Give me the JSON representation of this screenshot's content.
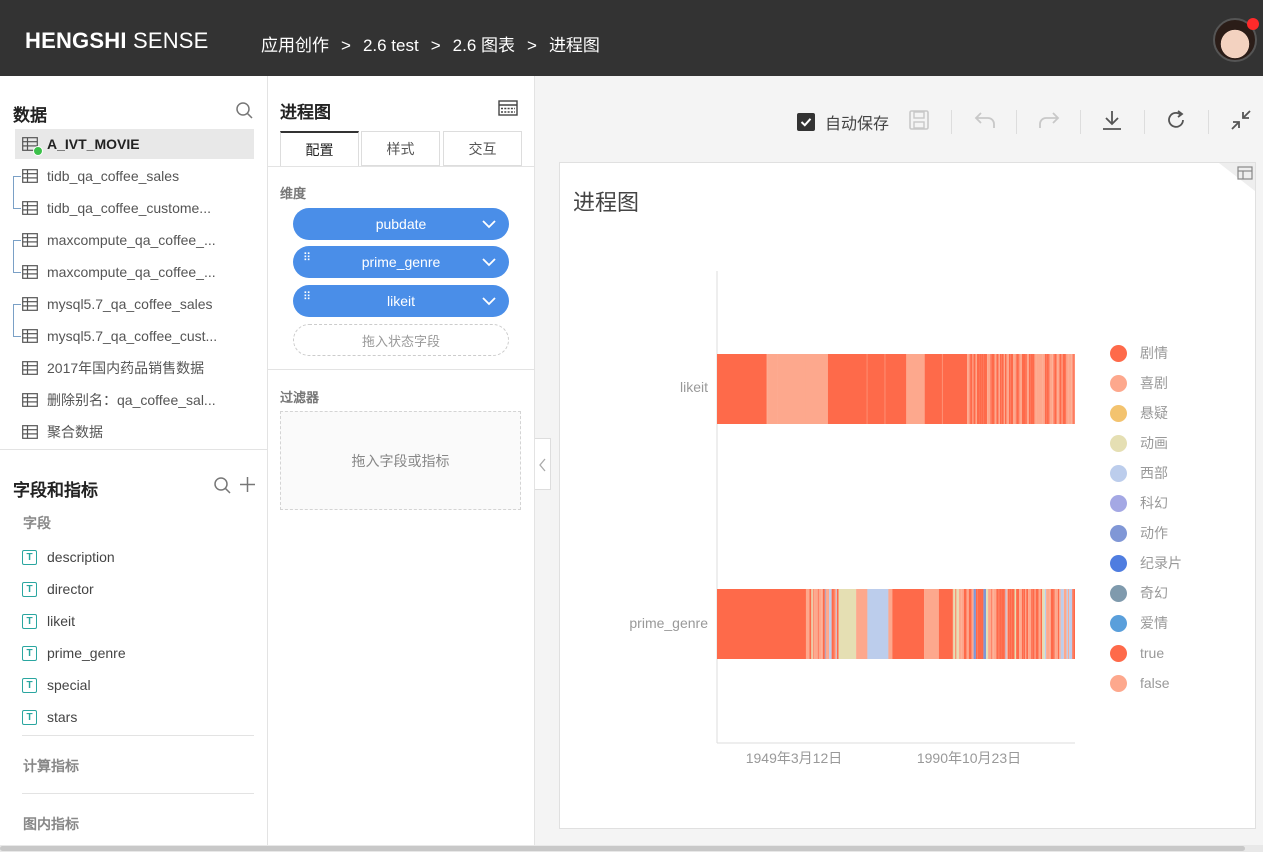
{
  "header": {
    "brand_bold": "HENGSHI",
    "brand_rest": " SENSE",
    "breadcrumb": [
      "应用创作",
      "2.6 test",
      "2.6 图表",
      "进程图"
    ],
    "breadcrumb_sep": ">"
  },
  "data_panel": {
    "title": "数据",
    "tables": [
      {
        "label": "A_IVT_MOVIE",
        "active": true
      },
      {
        "label": "tidb_qa_coffee_sales"
      },
      {
        "label": "tidb_qa_coffee_custome..."
      },
      {
        "label": "maxcompute_qa_coffee_..."
      },
      {
        "label": "maxcompute_qa_coffee_..."
      },
      {
        "label": "mysql5.7_qa_coffee_sales"
      },
      {
        "label": "mysql5.7_qa_coffee_cust..."
      },
      {
        "label": "2017年国内药品销售数据"
      },
      {
        "label": "删除别名：qa_coffee_sal..."
      },
      {
        "label": "聚合数据"
      }
    ]
  },
  "fields_panel": {
    "title": "字段和指标",
    "fields_label": "字段",
    "fields": [
      "description",
      "director",
      "likeit",
      "prime_genre",
      "special",
      "stars"
    ],
    "field_type_glyph": "T",
    "calc_label": "计算指标",
    "chart_metric_label": "图内指标"
  },
  "config": {
    "title": "进程图",
    "tabs": [
      "配置",
      "样式",
      "交互"
    ],
    "dimension_label": "维度",
    "dimensions": [
      "pubdate",
      "prime_genre",
      "likeit"
    ],
    "drop_state_placeholder": "拖入状态字段",
    "filter_label": "过滤器",
    "filter_placeholder": "拖入字段或指标"
  },
  "toolbar": {
    "autosave_label": "自动保存",
    "autosave_checked": true
  },
  "chart_card": {
    "title": "进程图"
  },
  "colors": {
    "topbar": "#333333",
    "pill": "#4a8ee8",
    "drama": "#fe6a4a",
    "comedy": "#fda88d"
  },
  "chart_data": {
    "type": "bar",
    "orientation": "horizontal-timeline",
    "categories": [
      "likeit",
      "prime_genre"
    ],
    "x_tick_labels": [
      "1949年3月12日",
      "1990年10月23日"
    ],
    "legend_position": "right",
    "legend": [
      {
        "name": "剧情",
        "color": "#fe6a4a"
      },
      {
        "name": "喜剧",
        "color": "#fda88d"
      },
      {
        "name": "悬疑",
        "color": "#f3c36f"
      },
      {
        "name": "动画",
        "color": "#e5dfb3"
      },
      {
        "name": "西部",
        "color": "#bccdec"
      },
      {
        "name": "科幻",
        "color": "#a4a8e4"
      },
      {
        "name": "动作",
        "color": "#8097d6"
      },
      {
        "name": "纪录片",
        "color": "#4f7de0"
      },
      {
        "name": "奇幻",
        "color": "#7f9aad"
      },
      {
        "name": "爱情",
        "color": "#5a9fdb"
      },
      {
        "name": "true",
        "color": "#fe6a4a"
      },
      {
        "name": "false",
        "color": "#fda88d"
      }
    ],
    "series": [
      {
        "category": "likeit",
        "segments": [
          {
            "from": 0.0,
            "to": 0.14,
            "state": "true"
          },
          {
            "from": 0.14,
            "to": 0.17,
            "state": "false"
          },
          {
            "from": 0.17,
            "to": 0.25,
            "state": "false"
          },
          {
            "from": 0.25,
            "to": 0.31,
            "state": "false"
          },
          {
            "from": 0.31,
            "to": 0.42,
            "state": "true"
          },
          {
            "from": 0.42,
            "to": 0.47,
            "state": "true"
          },
          {
            "from": 0.47,
            "to": 0.53,
            "state": "true"
          },
          {
            "from": 0.53,
            "to": 0.58,
            "state": "false"
          },
          {
            "from": 0.58,
            "to": 0.63,
            "state": "true"
          },
          {
            "from": 0.63,
            "to": 0.7,
            "state": "true"
          },
          {
            "from": 0.7,
            "to": 1.0,
            "state": "mixed"
          }
        ]
      },
      {
        "category": "prime_genre",
        "segments": [
          {
            "from": 0.0,
            "to": 0.25,
            "state": "剧情"
          },
          {
            "from": 0.25,
            "to": 0.34,
            "state": "mixed"
          },
          {
            "from": 0.34,
            "to": 0.39,
            "state": "动画"
          },
          {
            "from": 0.39,
            "to": 0.42,
            "state": "喜剧"
          },
          {
            "from": 0.42,
            "to": 0.48,
            "state": "西部"
          },
          {
            "from": 0.48,
            "to": 0.49,
            "state": "喜剧"
          },
          {
            "from": 0.49,
            "to": 0.58,
            "state": "剧情"
          },
          {
            "from": 0.58,
            "to": 0.62,
            "state": "喜剧"
          },
          {
            "from": 0.62,
            "to": 0.66,
            "state": "剧情"
          },
          {
            "from": 0.66,
            "to": 1.0,
            "state": "mixed"
          }
        ]
      }
    ]
  }
}
